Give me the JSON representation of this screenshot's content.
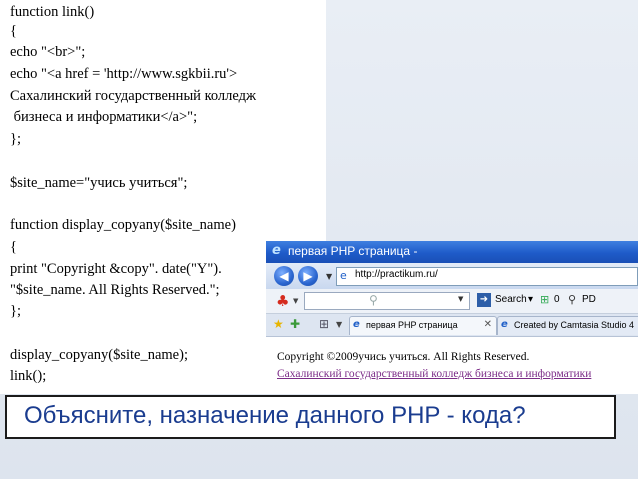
{
  "code": {
    "lines": [
      "function link()",
      "{",
      "echo \"<br>\";",
      "echo \"<a href = 'http://www.sgkbii.ru'>",
      "Сахалинский государственный колледж",
      " бизнеса и информатики</a>\";",
      "};",
      "",
      "$site_name=\"учись учиться\";",
      "",
      "function display_copyany($site_name)",
      "{",
      "print \"Copyright &copy\". date(\"Y\").",
      "\"$site_name. All Rights Reserved.\";",
      "};",
      "",
      "display_copyany($site_name);",
      "link();"
    ]
  },
  "browser": {
    "title": "первая PHP страница -",
    "url": "http://practikum.ru/",
    "toolbar": {
      "search_label": "Search",
      "count_a": "0",
      "pd_label": "PD"
    },
    "tabs": [
      {
        "label": "первая PHP страница"
      },
      {
        "label": "Created by Camtasia Studio 4"
      }
    ],
    "content": {
      "copyright": "Copyright ©2009учись учиться. All Rights Reserved.",
      "link": "Сахалинский государственный колледж бизнеса и информатики"
    }
  },
  "question": "Объясните, назначение данного PHP - кода?",
  "colors": {
    "question_text": "#1a3c8f",
    "titlebar": "#1e5bc9",
    "link_visited": "#7b2b87"
  }
}
